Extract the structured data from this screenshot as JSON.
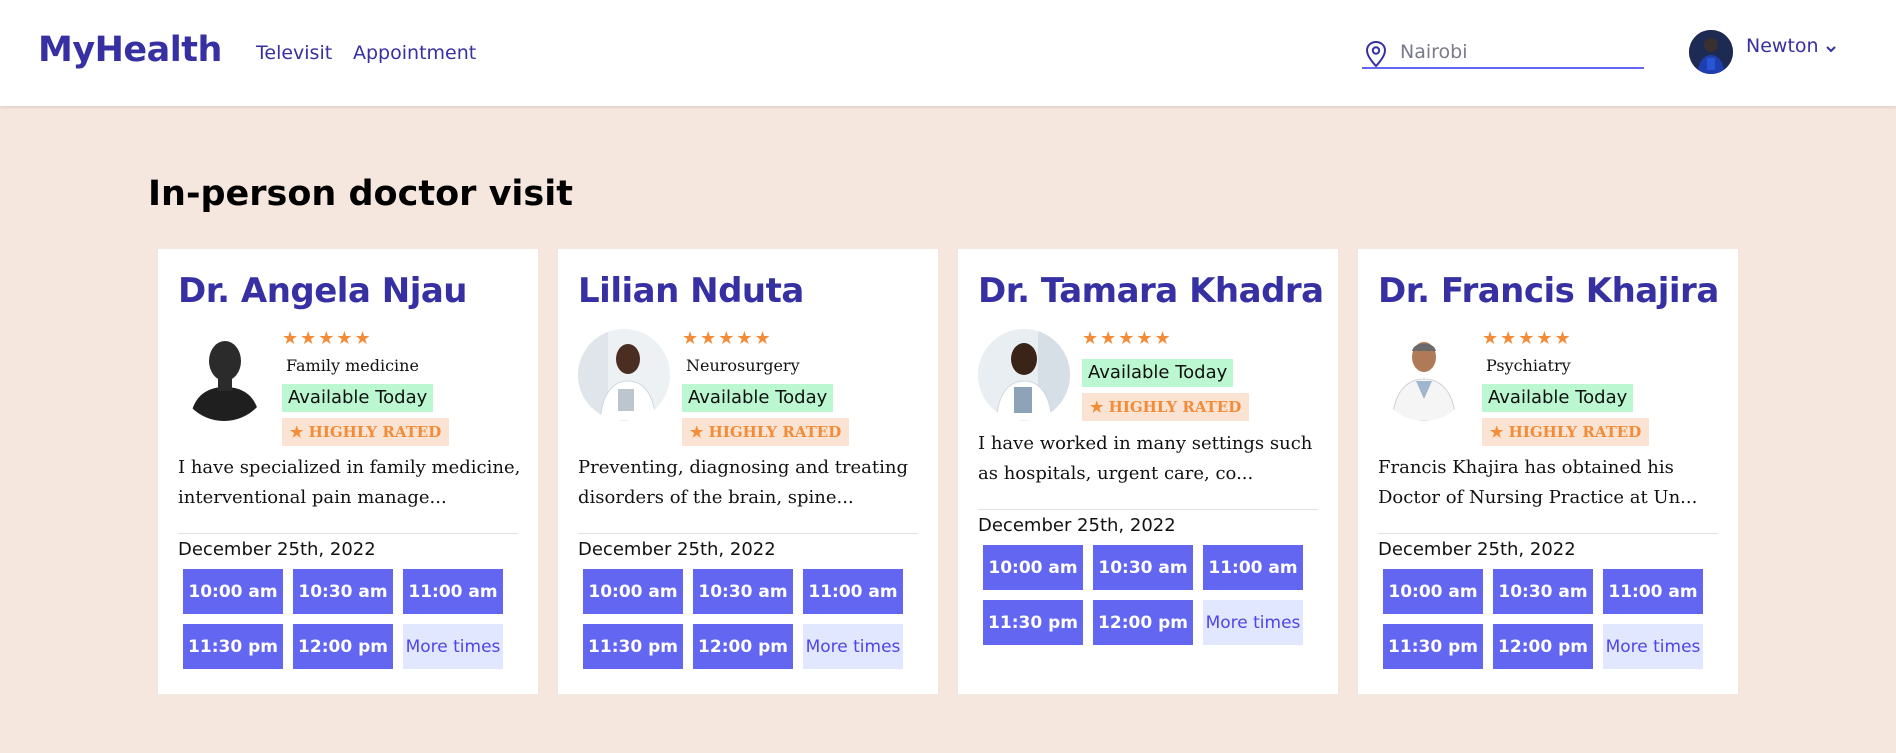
{
  "brand": "MyHealth",
  "nav": {
    "televisit": "Televisit",
    "appointment": "Appointment"
  },
  "location": {
    "placeholder": "Nairobi",
    "value": ""
  },
  "user": {
    "name": "Newton"
  },
  "page_title": "In-person doctor visit",
  "colors": {
    "accent": "#3730a3",
    "slot": "#6366f1",
    "available": "#bbf7d0",
    "rated": "#f28c38",
    "background": "#f5e7de"
  },
  "doctors": [
    {
      "name": "Dr. Angela Njau",
      "stars": "★★★★★",
      "specialty": "Family medicine",
      "available": "Available Today",
      "badge": "★ HIGHLY RATED",
      "description": "I have specialized in family medicine, interventional pain manage...",
      "date": "December 25th, 2022",
      "slots": [
        "10:00 am",
        "10:30 am",
        "11:00 am",
        "11:30 pm",
        "12:00 pm"
      ],
      "more": "More times"
    },
    {
      "name": "Lilian Nduta",
      "stars": "★★★★★",
      "specialty": "Neurosurgery",
      "available": "Available Today",
      "badge": "★ HIGHLY RATED",
      "description": "Preventing, diagnosing and treating disorders of the brain, spine...",
      "date": "December 25th, 2022",
      "slots": [
        "10:00 am",
        "10:30 am",
        "11:00 am",
        "11:30 pm",
        "12:00 pm"
      ],
      "more": "More times"
    },
    {
      "name": "Dr. Tamara Khadra",
      "stars": "★★★★★",
      "specialty": "",
      "available": "Available Today",
      "badge": "★ HIGHLY RATED",
      "description": "I have worked in many settings such as hospitals, urgent care, co...",
      "date": "December 25th, 2022",
      "slots": [
        "10:00 am",
        "10:30 am",
        "11:00 am",
        "11:30 pm",
        "12:00 pm"
      ],
      "more": "More times"
    },
    {
      "name": "Dr. Francis Khajira",
      "stars": "★★★★★",
      "specialty": "Psychiatry",
      "available": "Available Today",
      "badge": "★ HIGHLY RATED",
      "description": "Francis Khajira has obtained his Doctor of Nursing Practice at Un...",
      "date": "December 25th, 2022",
      "slots": [
        "10:00 am",
        "10:30 am",
        "11:00 am",
        "11:30 pm",
        "12:00 pm"
      ],
      "more": "More times"
    }
  ]
}
